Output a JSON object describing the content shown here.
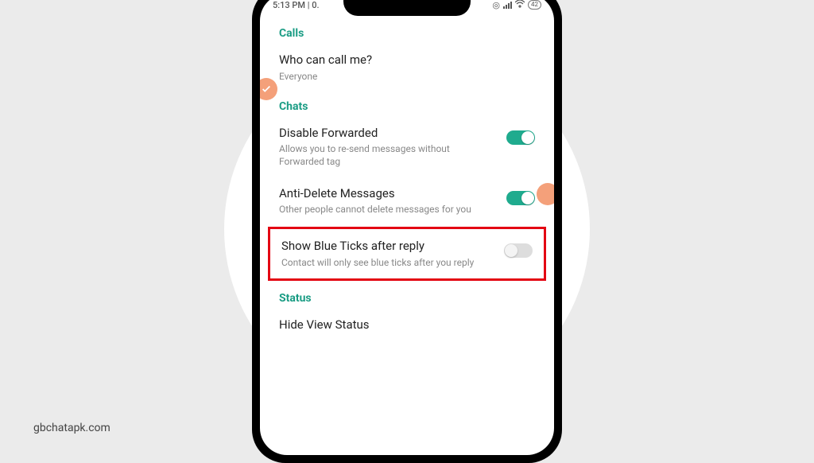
{
  "watermark": "gbchatapk.com",
  "statusBar": {
    "time": "5:13 PM | 0.",
    "battery": "42"
  },
  "sections": {
    "calls": {
      "header": "Calls",
      "whoCanCall": {
        "title": "Who can call me?",
        "value": "Everyone"
      }
    },
    "chats": {
      "header": "Chats",
      "disableForwarded": {
        "title": "Disable Forwarded",
        "desc": "Allows you to re-send messages without Forwarded tag"
      },
      "antiDelete": {
        "title": "Anti-Delete Messages",
        "desc": "Other people cannot delete messages for you"
      },
      "blueTicks": {
        "title": "Show Blue Ticks after reply",
        "desc": "Contact will only see blue ticks after you reply"
      }
    },
    "status": {
      "header": "Status",
      "hideView": {
        "title": "Hide View Status"
      }
    }
  }
}
